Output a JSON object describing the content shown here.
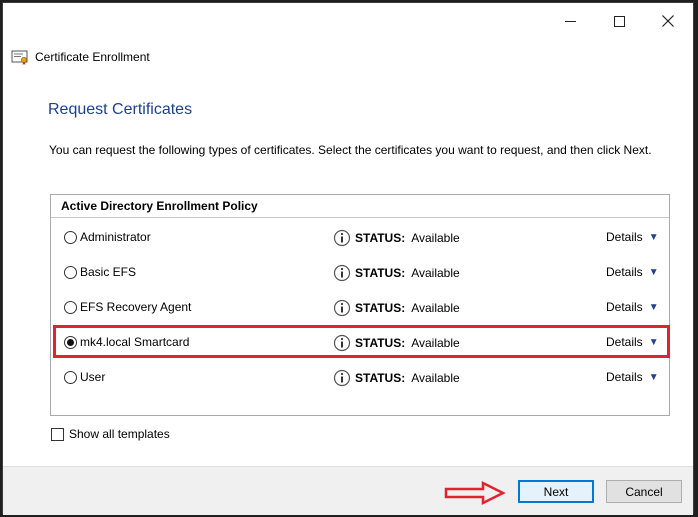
{
  "window": {
    "title": "Certificate Enrollment"
  },
  "page": {
    "title": "Request Certificates",
    "intro": "You can request the following types of certificates. Select the certificates you want to request, and then click Next."
  },
  "policy": {
    "header": "Active Directory Enrollment Policy",
    "status_label": "STATUS:",
    "details_label": "Details",
    "items": [
      {
        "name": "Administrator",
        "status": "Available",
        "selected": false
      },
      {
        "name": "Basic EFS",
        "status": "Available",
        "selected": false
      },
      {
        "name": "EFS Recovery Agent",
        "status": "Available",
        "selected": false
      },
      {
        "name": "mk4.local Smartcard",
        "status": "Available",
        "selected": true
      },
      {
        "name": "User",
        "status": "Available",
        "selected": false
      }
    ]
  },
  "options": {
    "show_all_templates": "Show all templates",
    "show_all_checked": false
  },
  "buttons": {
    "next": "Next",
    "cancel": "Cancel"
  },
  "colors": {
    "title_blue": "#1f3f8f",
    "highlight_red": "#e2222f",
    "default_button_border": "#0078d7"
  }
}
